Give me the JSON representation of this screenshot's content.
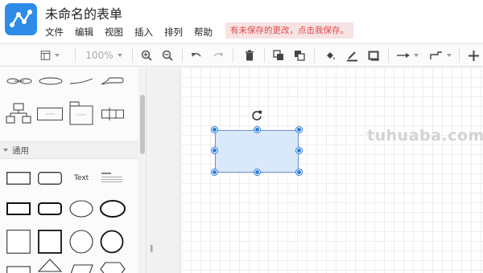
{
  "header": {
    "title": "未命名的表单",
    "menu": [
      "文件",
      "编辑",
      "视图",
      "插入",
      "排列",
      "帮助"
    ],
    "unsaved_notice": "有未保存的更改，点击我保存。",
    "logo_icon": "app-logo-icon"
  },
  "toolbar": {
    "zoom": "100%",
    "icons": [
      "page-layout-icon",
      "zoom-in-icon",
      "zoom-out-icon",
      "undo-icon",
      "redo-icon",
      "delete-icon",
      "to-front-icon",
      "to-back-icon",
      "fill-color-icon",
      "line-color-icon",
      "shadow-icon",
      "connection-arrow-icon",
      "waypoint-icon",
      "insert-plus-icon"
    ]
  },
  "sidebar": {
    "section_label": "通用",
    "text_shape_label": "Text"
  },
  "canvas": {
    "watermark": "tuhuaba.com",
    "selected_fill": "#dae8fc",
    "selected_stroke": "#6c8ebf",
    "handle_color": "#2a7de1"
  }
}
